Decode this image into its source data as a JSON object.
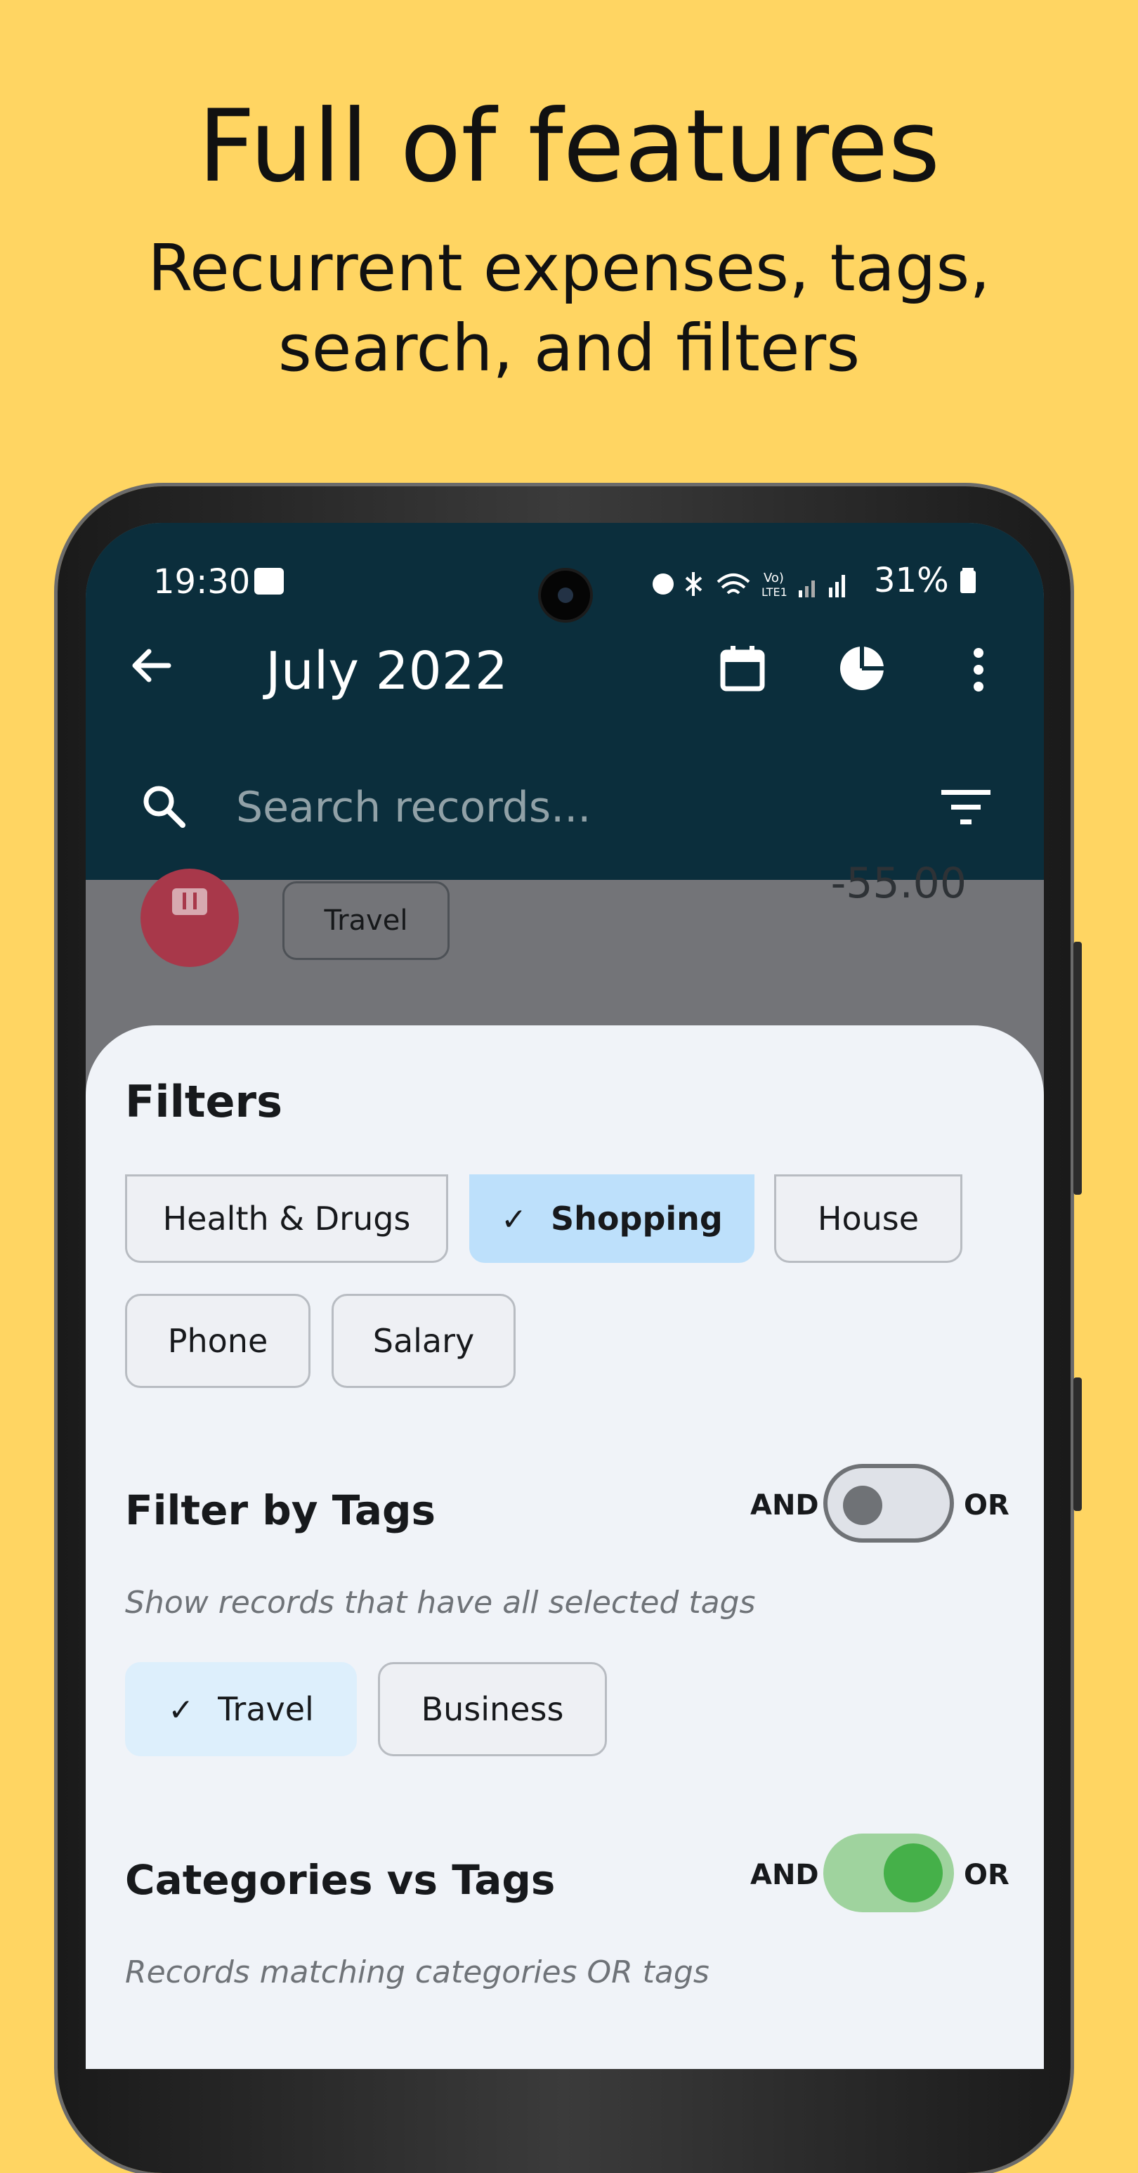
{
  "headline": "Full of features",
  "subline_1": "Recurrent expenses, tags,",
  "subline_2": "search, and filters",
  "status": {
    "time": "19:30",
    "battery": "31%"
  },
  "appbar": {
    "title": "July 2022"
  },
  "search": {
    "placeholder": "Search records..."
  },
  "background_record": {
    "tag": "Travel",
    "amount": "-55.00"
  },
  "filters": {
    "title": "Filters",
    "categories": [
      {
        "label": "Health & Drugs",
        "selected": false
      },
      {
        "label": "Shopping",
        "selected": true
      },
      {
        "label": "House",
        "selected": false
      },
      {
        "label": "Phone",
        "selected": false
      },
      {
        "label": "Salary",
        "selected": false
      }
    ],
    "tags_section": {
      "title": "Filter by Tags",
      "and_label": "AND",
      "or_label": "OR",
      "toggle_state": "off",
      "hint": "Show records that have all selected tags",
      "tags": [
        {
          "label": "Travel",
          "selected": true
        },
        {
          "label": "Business",
          "selected": false
        }
      ]
    },
    "cat_vs_tags": {
      "title": "Categories vs Tags",
      "and_label": "AND",
      "or_label": "OR",
      "toggle_state": "on",
      "hint": "Records matching categories OR tags"
    }
  },
  "colors": {
    "background": "#FFD562",
    "appbar": "#0B2E3C",
    "selected_chip": "#BDE0FB",
    "toggle_on": "#45b049"
  }
}
